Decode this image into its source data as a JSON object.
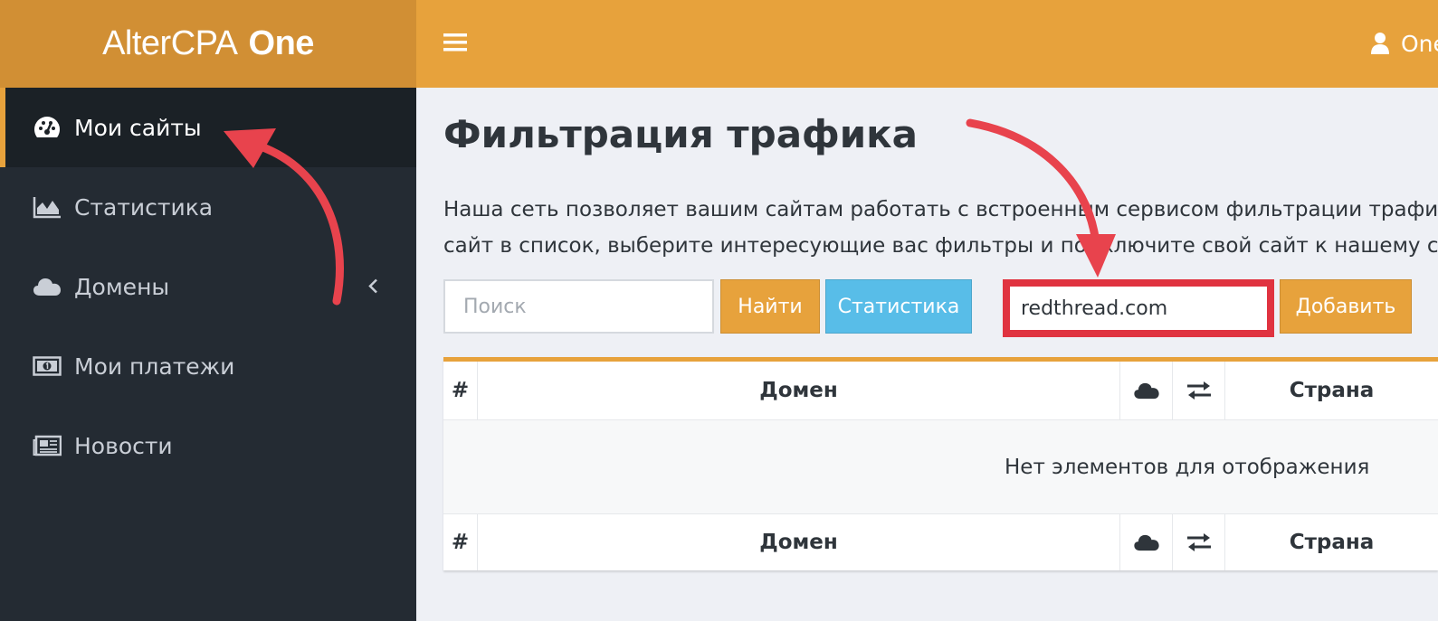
{
  "logo": {
    "light": "AlterCPA",
    "bold": "One"
  },
  "sidebar": {
    "items": [
      {
        "label": "Мои сайты",
        "icon": "dashboard-icon",
        "active": true
      },
      {
        "label": "Статистика",
        "icon": "area-chart-icon"
      },
      {
        "label": "Домены",
        "icon": "cloud-icon",
        "chevron": "chevron-left-icon"
      },
      {
        "label": "Мои платежи",
        "icon": "money-icon"
      },
      {
        "label": "Новости",
        "icon": "newspaper-icon"
      }
    ]
  },
  "topbar": {
    "menu_icon": "hamburger-icon",
    "user_icon": "user-icon",
    "user_name": "One"
  },
  "main": {
    "title": "Фильтрация трафика",
    "description": [
      "Наша сеть позволяет вашим сайтам работать с встроенным сервисом фильтрации трафика",
      "сайт в список, выберите интересующие вас фильтры и подключите свой сайт к нашему сервису"
    ],
    "search": {
      "placeholder": "Поиск",
      "value": ""
    },
    "find_label": "Найти",
    "stats_label": "Статистика",
    "domain_input": {
      "value": "redthread.com"
    },
    "add_label": "Добавить"
  },
  "table": {
    "columns": {
      "num": "#",
      "domain": "Домен",
      "cloud": "cloud-icon",
      "swap": "exchange-icon",
      "country": "Страна"
    },
    "empty_message": "Нет элементов для отображения"
  },
  "colors": {
    "accent": "#e7a23c",
    "logo_bg": "#d18f34",
    "sidebar_bg": "#242b33",
    "info": "#58bde8",
    "highlight": "#e03340"
  }
}
